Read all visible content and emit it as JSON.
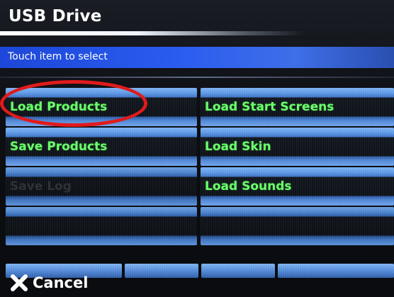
{
  "header": {
    "title": "USB Drive"
  },
  "hint": {
    "text": "Touch item to select"
  },
  "menu": {
    "left": [
      {
        "label": "Load Products",
        "state": "active"
      },
      {
        "label": "Save Products",
        "state": "active"
      },
      {
        "label": "Save Log",
        "state": "disabled"
      },
      {
        "label": "",
        "state": "empty"
      }
    ],
    "right": [
      {
        "label": "Load Start Screens",
        "state": "active"
      },
      {
        "label": "Load Skin",
        "state": "active"
      },
      {
        "label": "Load Sounds",
        "state": "active"
      },
      {
        "label": "",
        "state": "empty"
      }
    ]
  },
  "footer": {
    "cancel_label": "Cancel",
    "cancel_icon": "close-x-icon"
  },
  "colors": {
    "label_green": "#6cff6c",
    "disabled_label": "#2e3338",
    "hint_bar_blue": "#2a5cf0",
    "highlight_red": "#e01b1b"
  }
}
